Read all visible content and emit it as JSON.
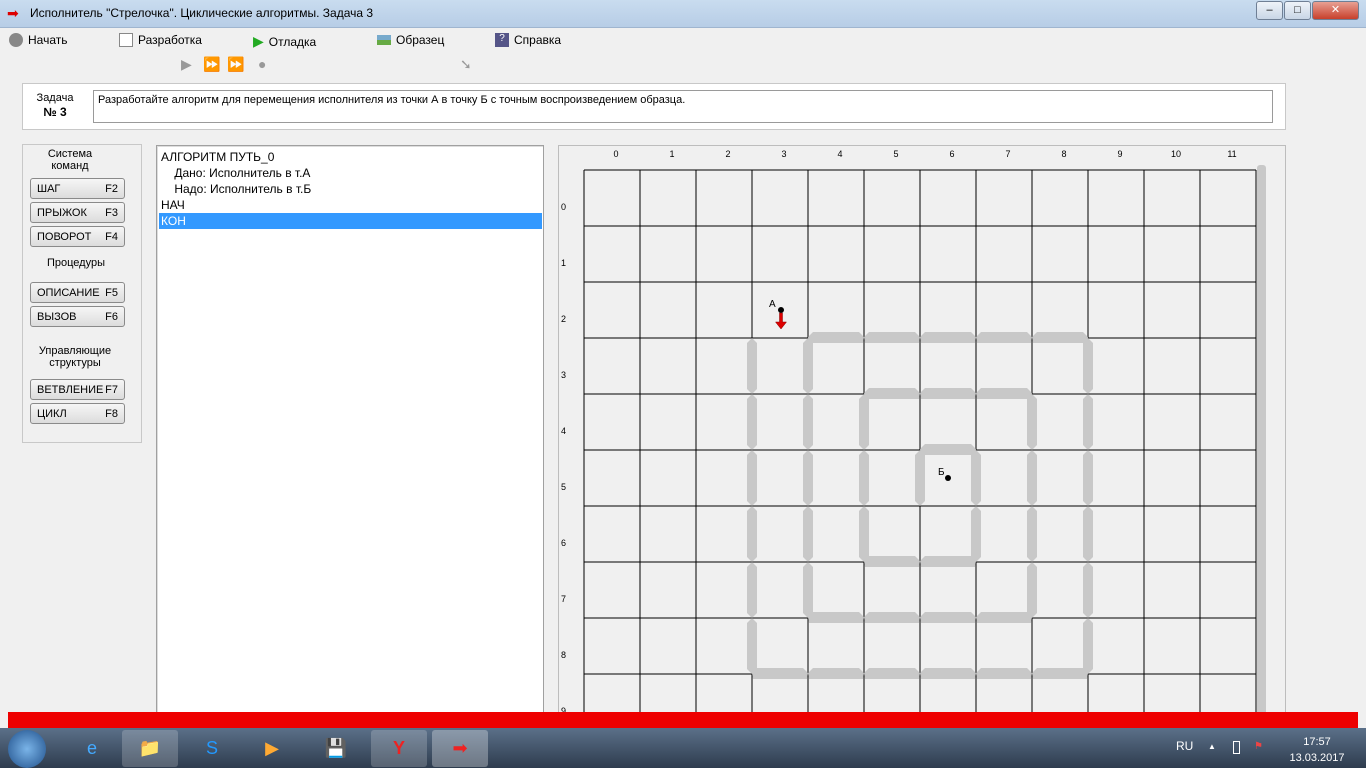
{
  "window": {
    "title": "Исполнитель \"Стрелочка\".  Циклические алгоритмы.  Задача 3",
    "minimize": "‒",
    "maximize": "□",
    "close": "✕"
  },
  "menu": [
    {
      "label": "Начать",
      "icon": "start-icon"
    },
    {
      "label": "Разработка",
      "icon": "document-icon"
    },
    {
      "label": "Отладка",
      "icon": "play-icon"
    },
    {
      "label": "Образец",
      "icon": "picture-icon"
    },
    {
      "label": "Справка",
      "icon": "help-icon"
    }
  ],
  "toolbar": {
    "run": "▶",
    "step": "⏩",
    "fast": "⏩",
    "stop": "●",
    "pointer": "➘"
  },
  "task": {
    "label": "Задача",
    "number": "№ 3",
    "text": "Разработайте алгоритм для перемещения исполнителя из точки А в точку Б с точным воспроизведением образца."
  },
  "commands": {
    "system_title": "Система команд",
    "buttons": [
      {
        "label": "ШАГ",
        "key": "F2"
      },
      {
        "label": "ПРЫЖОК",
        "key": "F3"
      },
      {
        "label": "ПОВОРОТ",
        "key": "F4"
      }
    ],
    "procedures_title": "Процедуры",
    "proc_buttons": [
      {
        "label": "ОПИСАНИЕ",
        "key": "F5"
      },
      {
        "label": "ВЫЗОВ",
        "key": "F6"
      }
    ],
    "control_title": "Управляющие структуры",
    "control_buttons": [
      {
        "label": "ВЕТВЛЕНИЕ",
        "key": "F7"
      },
      {
        "label": "ЦИКЛ",
        "key": "F8"
      }
    ]
  },
  "editor": {
    "lines": [
      "АЛГОРИТМ ПУТЬ_0",
      "    Дано: Исполнитель в т.А",
      "    Надо: Исполнитель в т.Б",
      "НАЧ",
      "КОН"
    ],
    "selected": 4
  },
  "field": {
    "columns": [
      "0",
      "1",
      "2",
      "3",
      "4",
      "5",
      "6",
      "7",
      "8",
      "9",
      "10",
      "11"
    ],
    "rows": [
      "0",
      "1",
      "2",
      "3",
      "4",
      "5",
      "6",
      "7",
      "8",
      "9"
    ],
    "point_a": {
      "label": "А",
      "col": 3,
      "row": 2
    },
    "point_b": {
      "label": "Б",
      "col": 6,
      "row": 5
    },
    "arrow_direction": "down",
    "h_walls": [
      [
        3,
        4
      ],
      [
        3,
        5
      ],
      [
        3,
        6
      ],
      [
        3,
        7
      ],
      [
        3,
        8
      ],
      [
        4,
        5
      ],
      [
        4,
        6
      ],
      [
        4,
        7
      ],
      [
        5,
        6
      ],
      [
        7,
        5
      ],
      [
        7,
        6
      ],
      [
        8,
        4
      ],
      [
        8,
        5
      ],
      [
        8,
        6
      ],
      [
        8,
        7
      ],
      [
        9,
        3
      ],
      [
        9,
        4
      ],
      [
        9,
        5
      ],
      [
        9,
        6
      ],
      [
        9,
        7
      ],
      [
        9,
        8
      ]
    ],
    "v_walls": [
      [
        3,
        3
      ],
      [
        3,
        4
      ],
      [
        3,
        5
      ],
      [
        3,
        6
      ],
      [
        3,
        7
      ],
      [
        3,
        8
      ],
      [
        4,
        3
      ],
      [
        4,
        4
      ],
      [
        4,
        5
      ],
      [
        4,
        6
      ],
      [
        4,
        7
      ],
      [
        5,
        4
      ],
      [
        5,
        5
      ],
      [
        5,
        6
      ],
      [
        6,
        5
      ],
      [
        7,
        5
      ],
      [
        7,
        6
      ],
      [
        8,
        4
      ],
      [
        8,
        5
      ],
      [
        8,
        6
      ],
      [
        8,
        7
      ],
      [
        9,
        3
      ],
      [
        9,
        4
      ],
      [
        9,
        5
      ],
      [
        9,
        6
      ],
      [
        9,
        7
      ],
      [
        9,
        8
      ]
    ],
    "wall_color": "#c8c8c8",
    "arrow_color": "#dd0000"
  },
  "tray": {
    "lang": "RU",
    "show_hidden": "▲",
    "time": "17:57",
    "date": "13.03.2017"
  },
  "taskbar": [
    "start-button",
    "ie-icon",
    "explorer-icon",
    "skype-icon",
    "media-icon",
    "save-icon",
    "yandex-icon",
    "strelochka-icon"
  ]
}
